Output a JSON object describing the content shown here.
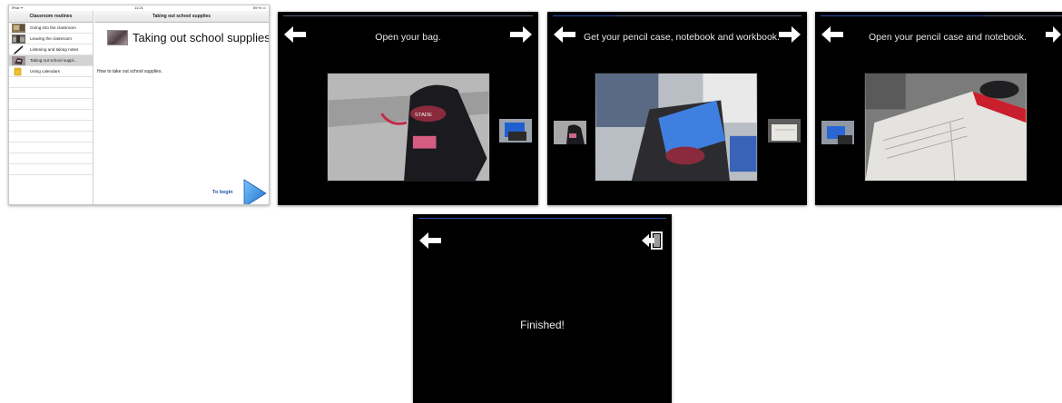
{
  "screen1": {
    "status": {
      "left": "iPad ᯤ",
      "time": "11:21",
      "right": "59 % ▭"
    },
    "master_title": "Classroom routines",
    "detail_title": "Taking out school supplies",
    "items": [
      {
        "label": "Going into the classroom",
        "thumb": "classroom-photo",
        "selected": false
      },
      {
        "label": "Leaving the classroom",
        "thumb": "classroom-photo",
        "selected": false
      },
      {
        "label": "Listening and taking notes",
        "thumb": "pencil-icon",
        "selected": false
      },
      {
        "label": "Taking out school suppl...",
        "thumb": "supplies-photo",
        "selected": true
      },
      {
        "label": "Using calendars",
        "thumb": "calendar-icon",
        "selected": false
      }
    ],
    "heading": "Taking out school supplies",
    "description": "How to take out school supplies.",
    "begin_label": "To begin",
    "colors": {
      "accent": "#1f55a8",
      "arrow": "#2b8ad8"
    }
  },
  "screen2": {
    "caption": "Open your bag."
  },
  "screen3": {
    "caption": "Get your pencil case, notebook and workbook."
  },
  "screen4": {
    "caption": "Open your pencil case and notebook."
  },
  "screen5": {
    "message": "Finished!"
  },
  "icons": {
    "back": "left-arrow-icon",
    "next": "right-arrow-icon",
    "exit": "exit-icon"
  }
}
